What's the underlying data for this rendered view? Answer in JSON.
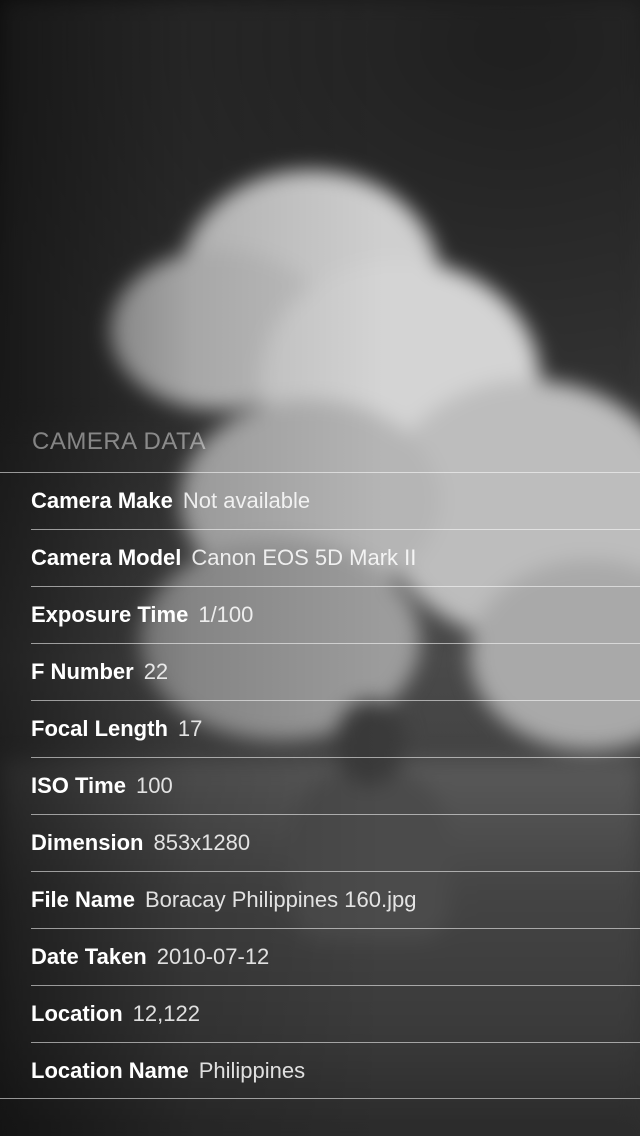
{
  "section": {
    "title": "CAMERA DATA"
  },
  "rows": [
    {
      "label": "Camera Make",
      "value": "Not available"
    },
    {
      "label": "Camera Model",
      "value": "Canon EOS 5D Mark II"
    },
    {
      "label": "Exposure Time",
      "value": "1/100"
    },
    {
      "label": "F Number",
      "value": "22"
    },
    {
      "label": "Focal Length",
      "value": "17"
    },
    {
      "label": "ISO Time",
      "value": "100"
    },
    {
      "label": "Dimension",
      "value": "853x1280"
    },
    {
      "label": "File Name",
      "value": "Boracay Philippines 160.jpg"
    },
    {
      "label": "Date Taken",
      "value": "2010-07-12"
    },
    {
      "label": "Location",
      "value": "12,122"
    },
    {
      "label": "Location Name",
      "value": "Philippines"
    }
  ]
}
